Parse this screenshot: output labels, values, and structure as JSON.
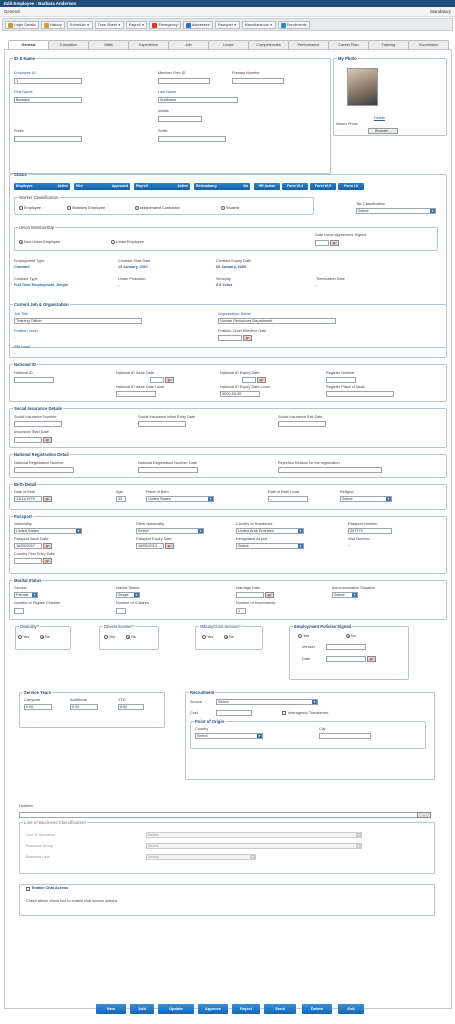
{
  "window": {
    "title": "Edit Employee : Barbara Anderson",
    "section": "General",
    "mandatory": "Mandatory"
  },
  "toolbar": [
    {
      "label": "Login Details",
      "icon": "login-icon",
      "color": "#c79a2a",
      "caret": false
    },
    {
      "label": "History",
      "icon": "history-icon",
      "color": "#d8a030",
      "caret": false
    },
    {
      "label": "Schedule",
      "icon": "",
      "caret": true
    },
    {
      "label": "Time Sheet",
      "icon": "",
      "caret": true
    },
    {
      "label": "Payroll",
      "icon": "",
      "caret": true
    },
    {
      "label": "Emergency",
      "icon": "emergency-icon",
      "color": "#d83a2a",
      "caret": false
    },
    {
      "label": "Addresses",
      "icon": "addresses-icon",
      "color": "#2a6ec8",
      "caret": false
    },
    {
      "label": "Passport",
      "icon": "",
      "caret": true
    },
    {
      "label": "Miscellaneous",
      "icon": "",
      "caret": true
    },
    {
      "label": "Enrollments",
      "icon": "enrollments-icon",
      "color": "#2a8ac8",
      "caret": false
    }
  ],
  "tabs": [
    "General",
    "Education",
    "Skills",
    "Experience",
    "Job",
    "Leave",
    "Competencies",
    "Performance",
    "Career Plan",
    "Training",
    "Succession"
  ],
  "id_name": {
    "legend": "ID & Name",
    "employee_id_label": "Employee ID",
    "employee_id": "1",
    "member_firm_id_label": "Member Firm ID",
    "primary_number_label": "Primary Number",
    "first_name_label": "First Name",
    "first_name": "Barbara",
    "last_name_label": "Last Name",
    "last_name": "Anderson",
    "initials_label": "Initials",
    "prefix_label": "Prefix",
    "suffix_label": "Suffix"
  },
  "my_photo": {
    "legend": "My Photo",
    "delete": "Delete",
    "attach": "Attach Photo",
    "browse": "Browse..."
  },
  "status": {
    "legend": "Status",
    "badges": [
      {
        "label": "Employee",
        "value": "Active"
      },
      {
        "label": "Hire",
        "value": "Approved"
      },
      {
        "label": "Payroll",
        "value": "Active"
      },
      {
        "label": "Redundancy",
        "value": "No"
      }
    ],
    "action_buttons": [
      "HR Action",
      "Form W-4",
      "Form W-5",
      "Form I-9"
    ],
    "worker_legend": "Worker Classification",
    "worker_options": [
      "Employee",
      "Statutory Employee",
      "Independent Contractor",
      "Student"
    ],
    "tax_label": "Tax Classification",
    "tax_value": "Select",
    "union_legend": "Union Membership",
    "union_options": [
      "Non-Union Employee",
      "Union Employee"
    ],
    "union_date_label": "Date Union Agreement Signed",
    "employment_type_label": "Employment Type",
    "employment_type": "Contract",
    "contract_start_label": "Contract Start Date",
    "contract_start": "10 January, 2007",
    "contract_expiry_label": "Contract Expiry Date",
    "contract_expiry": "09 January, 2009",
    "contract_type_label": "Contract Type",
    "contract_type": "Full Time Employment_Single",
    "under_probation_label": "Under Probation",
    "under_probation": "-",
    "seniority_label": "Seniority",
    "seniority": "6.6 Years",
    "termination_label": "Termination Date",
    "termination": "-"
  },
  "job": {
    "legend": "Current Job & Organization",
    "job_title_label": "Job Title",
    "job_title": "Training Officer",
    "org_label": "Organization Name",
    "org": "Human Resources Department",
    "position_level_label": "Position Level",
    "position_level": "-",
    "position_eff_label": "Position Level Effective Date",
    "pbi_label": "PBI Level",
    "pbi": "-"
  },
  "national": {
    "legend": "National ID",
    "id_label": "National ID",
    "issue_label": "National ID Issue Date",
    "expiry_label": "National ID Expiry Date",
    "register_label": "Register Number",
    "issue_local_label": "National ID Issue Date Local",
    "issue_local": "--",
    "expiry_local_label": "National ID Expiry Date Local",
    "expiry_local": "0000-00-00",
    "register_place_label": "Register Place of Issue"
  },
  "social": {
    "legend": "Social Insurance Details",
    "number_label": "Social Insurance Number",
    "initial_label": "Social Insurance Initial Entry Date",
    "exit_label": "Social Insurance Exit Date",
    "start_label": "Insurance Start Date"
  },
  "natreg": {
    "legend": "National Registration Detail",
    "number_label": "National Registration Number",
    "date_label": "National Registration Number Date",
    "reason_label": "Rejection Reason for the registration"
  },
  "birth": {
    "legend": "Birth Detail",
    "dob_label": "Date of Birth",
    "dob": "13/11/1979",
    "age_label": "Age",
    "age": "33",
    "place_label": "Place of Birth",
    "place": "United States",
    "local_label": "Date of Birth Local",
    "local": "--",
    "religion_label": "Religion",
    "religion": "Select"
  },
  "passport": {
    "legend": "Passport",
    "nationality_label": "Nationality",
    "nationality": "United States",
    "other_label": "Other Nationality",
    "other": "Select",
    "residence_label": "Country of Residence",
    "residence": "United Arab Emirates",
    "number_label": "Passport Number",
    "number": "297273",
    "issue_label": "Passport Issue Date",
    "issue": "16/05/2007",
    "expiry_label": "Passport Expiry Date",
    "expiry": "16/05/2012",
    "airport_label": "Designated Airport",
    "airport": "Select",
    "visa_label": "Visa Number",
    "visa": "--",
    "first_entry_label": "Country First Entry Date"
  },
  "marital": {
    "legend": "Marital Status",
    "gender_label": "Gender",
    "gender": "Female",
    "status_label": "Marital Status",
    "status": "Single",
    "marriage_label": "Marriage Date",
    "accommodation_label": "Accommodation Situation",
    "accommodation": "Select",
    "eligible_label": "Number of Eligible Children",
    "children_label": "Number of Children",
    "dependents_label": "Number of Dependents",
    "dependents": "1"
  },
  "yesno": {
    "disability": "Disability?",
    "license": "Drivers license?",
    "military": "Military/Govt.Service?",
    "yes": "Yes",
    "no": "No"
  },
  "policies": {
    "legend": "Employment Policies Signed",
    "version_label": "Version",
    "date_label": "Date"
  },
  "service": {
    "legend": "Service Years",
    "carryover_label": "Carryover",
    "carryover": "0.00",
    "additional_label": "Additional",
    "additional": "0.00",
    "ytd_label": "YTD",
    "ytd": "6.60"
  },
  "recruitment": {
    "legend": "Recruitment",
    "source_label": "Source",
    "source": "Select",
    "cost_label": "Cost",
    "interagency": "Interagency Transferred",
    "origin_legend": "Point of Origin",
    "country_label": "Country",
    "country": "Select",
    "city_label": "City"
  },
  "hobbies_label": "Hobbies",
  "lob": {
    "legend": "Line of Business Classification",
    "operation_label": "Line of Operation",
    "operation": "Select",
    "group_label": "Business Group",
    "group": "Select",
    "line_label": "Business Line",
    "line": "Select"
  },
  "chat": {
    "legend": "Enable Chat Access",
    "note": "Check above check box to enable chat access options"
  },
  "bottom_buttons": [
    "New",
    "Add",
    "Update",
    "Approve",
    "Reject",
    "Send",
    "Delete",
    "Exit"
  ]
}
